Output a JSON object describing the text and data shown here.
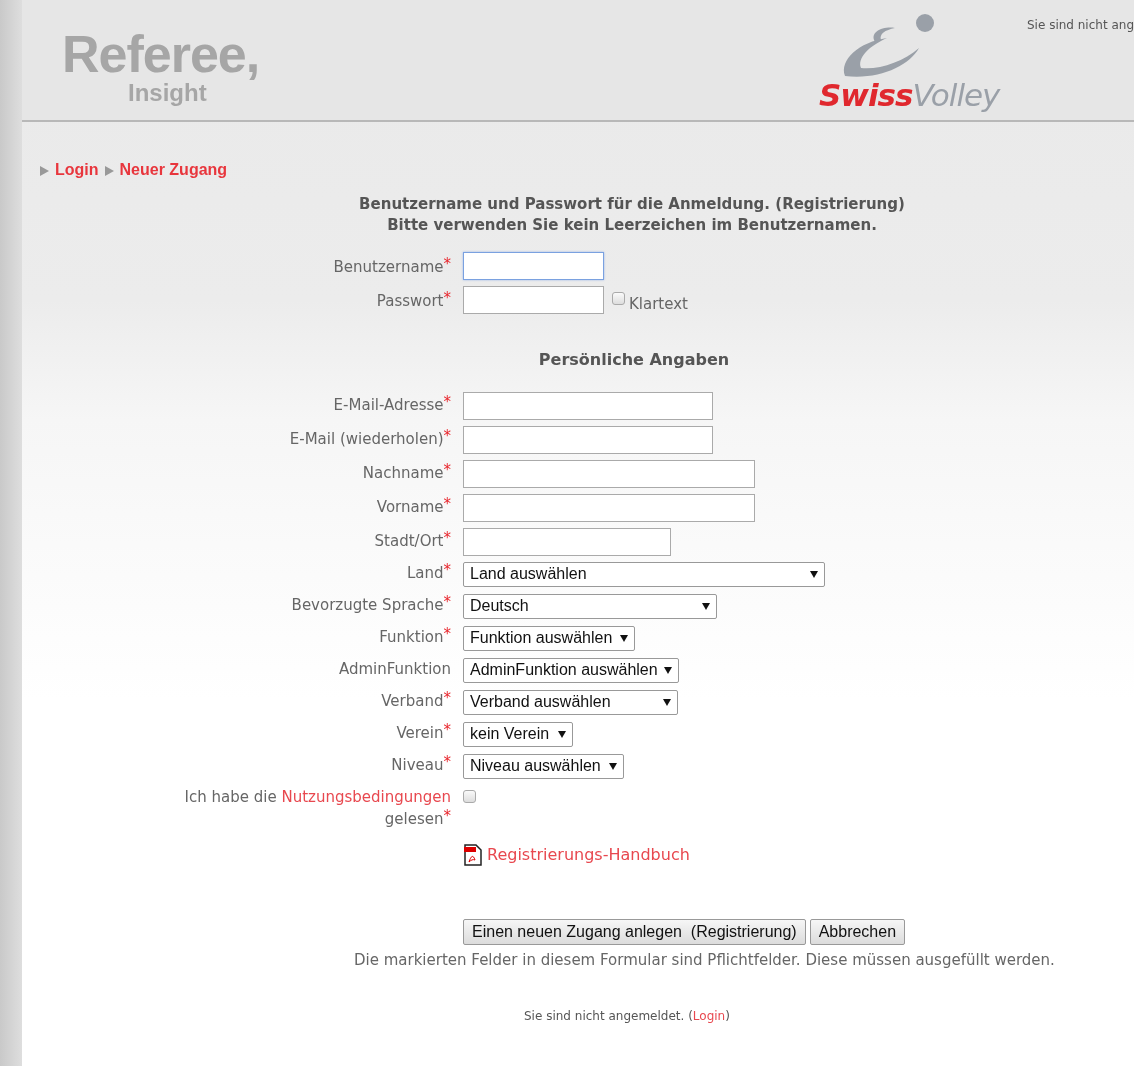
{
  "header": {
    "logo_title": "Referee,",
    "logo_subtitle": "Insight",
    "brand_first": "Swiss",
    "brand_second": "Volley",
    "status": "Sie sind nicht ang"
  },
  "breadcrumb": [
    "Login",
    "Neuer Zugang"
  ],
  "intro": [
    "Benutzername und Passwort für die Anmeldung. (Registrierung)",
    "Bitte verwenden Sie kein Leerzeichen im Benutzernamen."
  ],
  "required_mark": "*",
  "login_fields": [
    {
      "label": "Benutzername",
      "required": true,
      "focused": true
    },
    {
      "label": "Passwort",
      "required": true,
      "focused": false,
      "option": {
        "label": "Klartext",
        "checked": false
      }
    }
  ],
  "section_title": "Persönliche Angaben",
  "personal_fields": [
    {
      "kind": "text",
      "label": "E-Mail-Adresse",
      "required": true
    },
    {
      "kind": "text",
      "label": "E-Mail (wiederholen)",
      "required": true
    },
    {
      "kind": "text",
      "label": "Nachname",
      "required": true
    },
    {
      "kind": "text",
      "label": "Vorname",
      "required": true
    },
    {
      "kind": "text",
      "label": "Stadt/Ort",
      "required": true
    },
    {
      "kind": "select",
      "label": "Land",
      "required": true,
      "value": "Land auswählen"
    },
    {
      "kind": "select",
      "label": "Bevorzugte Sprache",
      "required": true,
      "value": "Deutsch"
    },
    {
      "kind": "select",
      "label": "Funktion",
      "required": true,
      "value": "Funktion auswählen"
    },
    {
      "kind": "select",
      "label": "AdminFunktion",
      "required": false,
      "value": "AdminFunktion auswählen"
    },
    {
      "kind": "select",
      "label": "Verband",
      "required": true,
      "value": "Verband auswählen"
    },
    {
      "kind": "select",
      "label": "Verein",
      "required": true,
      "value": "kein Verein"
    },
    {
      "kind": "select",
      "label": "Niveau",
      "required": true,
      "value": "Niveau auswählen"
    }
  ],
  "terms": {
    "before": "Ich habe die",
    "link": "Nutzungsbedingungen",
    "after": "gelesen",
    "required": true,
    "checked": false
  },
  "manual_link": "Registrierungs-Handbuch",
  "buttons": [
    "Einen neuen Zugang anlegen  (Registrierung)",
    "Abbrechen"
  ],
  "note": "Die markierten Felder in diesem Formular sind Pflichtfelder. Diese müssen ausgefüllt werden.",
  "footer": {
    "before": "Sie sind nicht angemeldet. (",
    "link": "Login",
    "after": ")"
  }
}
